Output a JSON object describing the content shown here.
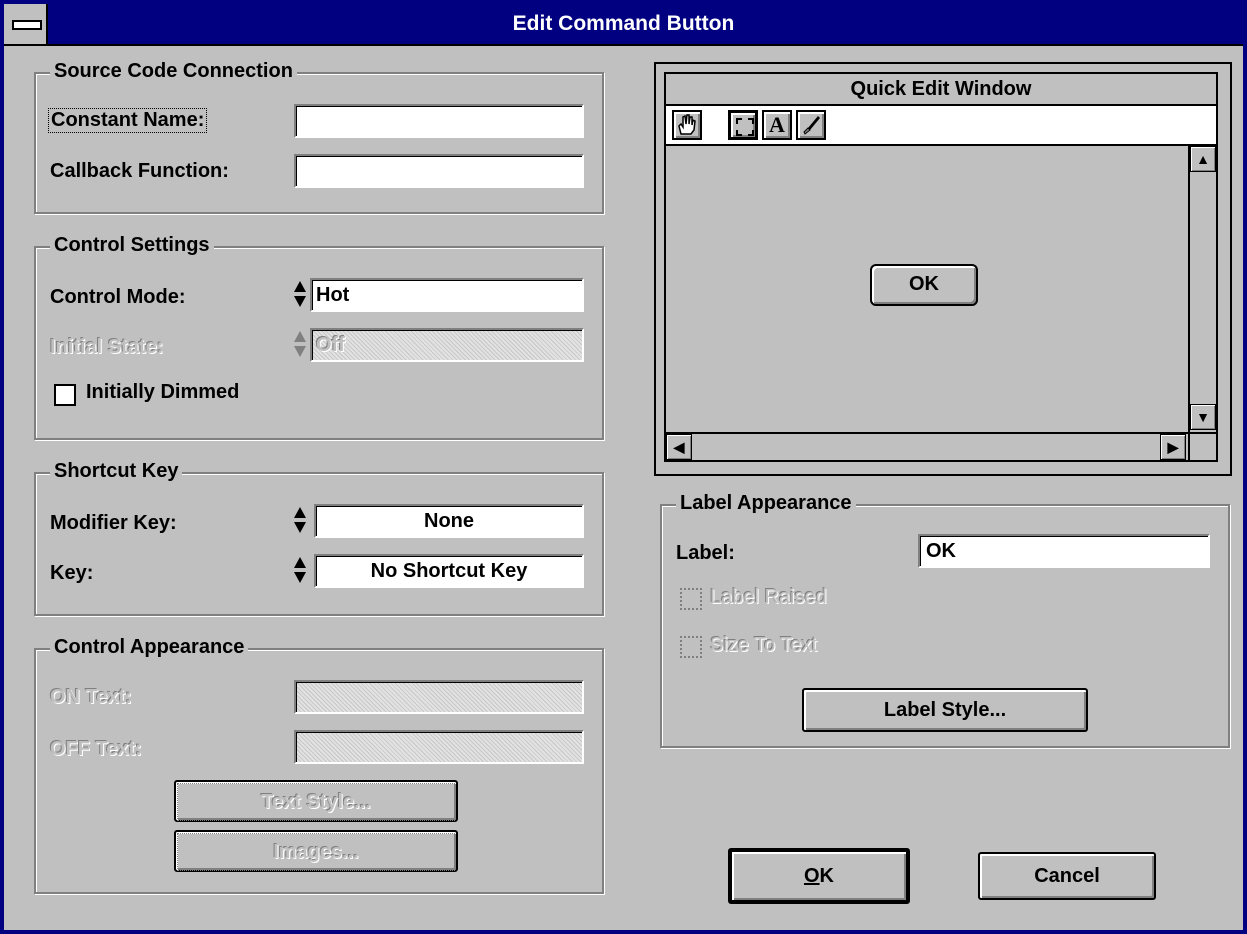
{
  "window": {
    "title": "Edit Command Button"
  },
  "source_code": {
    "legend": "Source Code Connection",
    "constant_name_label": "Constant Name:",
    "constant_name_value": "",
    "callback_label": "Callback Function:",
    "callback_value": ""
  },
  "control_settings": {
    "legend": "Control Settings",
    "mode_label": "Control Mode:",
    "mode_value": "Hot",
    "initial_state_label": "Initial State:",
    "initial_state_value": "Off",
    "initially_dimmed_label": "Initially Dimmed",
    "initially_dimmed_checked": false
  },
  "shortcut_key": {
    "legend": "Shortcut Key",
    "modifier_label": "Modifier Key:",
    "modifier_value": "None",
    "key_label": "Key:",
    "key_value": "No Shortcut Key"
  },
  "control_appearance": {
    "legend": "Control Appearance",
    "on_text_label": "ON Text:",
    "on_text_value": "",
    "off_text_label": "OFF Text:",
    "off_text_value": "",
    "text_style_button": "Text Style...",
    "images_button": "Images..."
  },
  "quick_edit": {
    "title": "Quick Edit Window",
    "tools": [
      "hand-tool-icon",
      "select-tool-icon",
      "text-tool-icon",
      "brush-tool-icon"
    ],
    "text_tool_glyph": "A",
    "preview_button_label": "OK"
  },
  "label_appearance": {
    "legend": "Label Appearance",
    "label_label": "Label:",
    "label_value": "OK",
    "label_raised": "Label Raised",
    "size_to_text": "Size To Text",
    "label_style_button": "Label Style..."
  },
  "dialog_buttons": {
    "ok_mnemonic": "O",
    "ok_rest": "K",
    "cancel": "Cancel"
  }
}
